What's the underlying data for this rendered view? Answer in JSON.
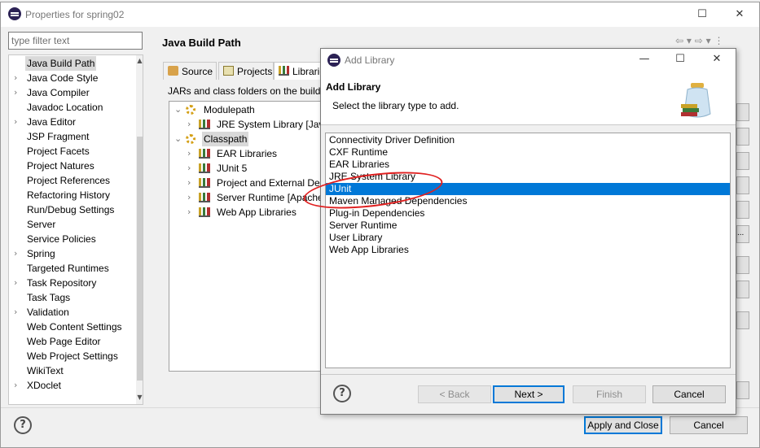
{
  "properties_dialog": {
    "title": "Properties for spring02",
    "filter_placeholder": "type filter text",
    "categories": [
      {
        "label": "Java Build Path",
        "expandable": false,
        "selected": true
      },
      {
        "label": "Java Code Style",
        "expandable": true
      },
      {
        "label": "Java Compiler",
        "expandable": true
      },
      {
        "label": "Javadoc Location",
        "expandable": false
      },
      {
        "label": "Java Editor",
        "expandable": true
      },
      {
        "label": "JSP Fragment",
        "expandable": false
      },
      {
        "label": "Project Facets",
        "expandable": false
      },
      {
        "label": "Project Natures",
        "expandable": false
      },
      {
        "label": "Project References",
        "expandable": false
      },
      {
        "label": "Refactoring History",
        "expandable": false
      },
      {
        "label": "Run/Debug Settings",
        "expandable": false
      },
      {
        "label": "Server",
        "expandable": false
      },
      {
        "label": "Service Policies",
        "expandable": false
      },
      {
        "label": "Spring",
        "expandable": true
      },
      {
        "label": "Targeted Runtimes",
        "expandable": false
      },
      {
        "label": "Task Repository",
        "expandable": true
      },
      {
        "label": "Task Tags",
        "expandable": false
      },
      {
        "label": "Validation",
        "expandable": true
      },
      {
        "label": "Web Content Settings",
        "expandable": false
      },
      {
        "label": "Web Page Editor",
        "expandable": false
      },
      {
        "label": "Web Project Settings",
        "expandable": false
      },
      {
        "label": "WikiText",
        "expandable": false
      },
      {
        "label": "XDoclet",
        "expandable": true
      }
    ],
    "page_title": "Java Build Path",
    "tabs": [
      {
        "label": "Source"
      },
      {
        "label": "Projects"
      },
      {
        "label": "Librarie",
        "active": true
      }
    ],
    "libraries_description": "JARs and class folders on the build",
    "build_tree": [
      {
        "label": "Modulepath",
        "level": 0,
        "expanded": true,
        "icon": "gears-icon"
      },
      {
        "label": "JRE System Library [Java",
        "level": 1,
        "expanded": false,
        "icon": "library-icon"
      },
      {
        "label": "Classpath",
        "level": 0,
        "expanded": true,
        "icon": "gears-icon",
        "selected": true
      },
      {
        "label": "EAR Libraries",
        "level": 1,
        "expanded": false,
        "icon": "library-icon"
      },
      {
        "label": "JUnit 5",
        "level": 1,
        "expanded": false,
        "icon": "library-icon"
      },
      {
        "label": "Project and External Dep",
        "level": 1,
        "expanded": false,
        "icon": "library-icon"
      },
      {
        "label": "Server Runtime [Apache",
        "level": 1,
        "expanded": false,
        "icon": "library-icon"
      },
      {
        "label": "Web App Libraries",
        "level": 1,
        "expanded": false,
        "icon": "library-icon"
      }
    ],
    "side_button_partial": "...",
    "apply_close_label": "Apply and Close",
    "cancel_label": "Cancel"
  },
  "add_library_dialog": {
    "title": "Add Library",
    "heading": "Add Library",
    "subtitle": "Select the library type to add.",
    "library_types": [
      {
        "label": "Connectivity Driver Definition"
      },
      {
        "label": "CXF Runtime"
      },
      {
        "label": "EAR Libraries"
      },
      {
        "label": "JRE System Library"
      },
      {
        "label": "JUnit",
        "selected": true
      },
      {
        "label": "Maven Managed Dependencies"
      },
      {
        "label": "Plug-in Dependencies"
      },
      {
        "label": "Server Runtime"
      },
      {
        "label": "User Library"
      },
      {
        "label": "Web App Libraries"
      }
    ],
    "back_label": "< Back",
    "next_label": "Next >",
    "finish_label": "Finish",
    "cancel_label": "Cancel"
  },
  "colors": {
    "selection_blue": "#0078d7",
    "annotation_red": "#e02020"
  }
}
